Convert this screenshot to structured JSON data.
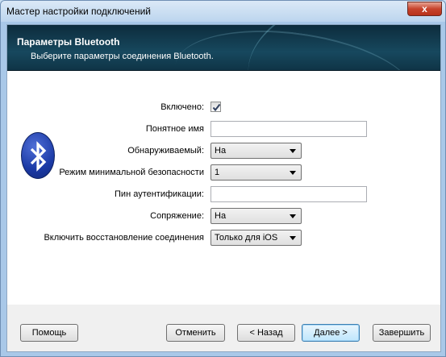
{
  "window": {
    "title": "Мастер настройки подключений",
    "close_label": "x"
  },
  "banner": {
    "title": "Параметры Bluetooth",
    "subtitle": "Выберите параметры соединения Bluetooth."
  },
  "icons": {
    "bluetooth_logo": "bluetooth-icon",
    "checkbox_mark": "checkmark-icon",
    "dropdown_arrow": "chevron-down-icon"
  },
  "form": {
    "enabled": {
      "label": "Включено:",
      "checked": true
    },
    "friendly_name": {
      "label": "Понятное имя",
      "value": ""
    },
    "discoverable": {
      "label": "Обнаруживаемый:",
      "value": "На"
    },
    "min_security": {
      "label": "Режим минимальной безопасности",
      "value": "1"
    },
    "pin": {
      "label": "Пин аутентификации:",
      "value": ""
    },
    "pairing": {
      "label": "Сопряжение:",
      "value": "На"
    },
    "reconnect": {
      "label": "Включить восстановление соединения",
      "value": "Только для iOS"
    }
  },
  "buttons": {
    "help": "Помощь",
    "cancel": "Отменить",
    "back": "< Назад",
    "next": "Далее >",
    "finish": "Завершить"
  },
  "colors": {
    "banner_bg": "#17485e",
    "window_border": "#a9c8e8",
    "close_button": "#c7432c"
  }
}
